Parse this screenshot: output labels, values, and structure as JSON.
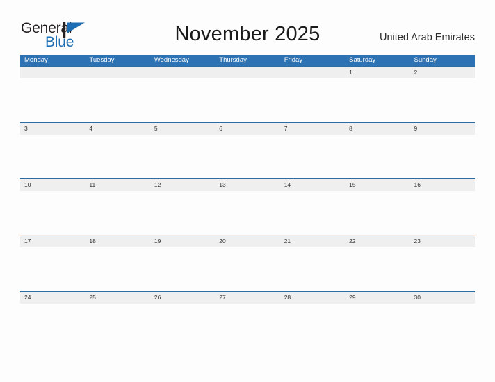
{
  "header": {
    "logo": {
      "name_part1": "General",
      "name_part2": "Blue",
      "flag_icon": "blue-flag-triangle-icon",
      "color_dark": "#231f20",
      "color_blue": "#1f6fb5"
    },
    "month_title": "November 2025",
    "locale": "United Arab Emirates"
  },
  "calendar": {
    "header_bg_color": "#2d72b2",
    "date_band_color": "#efefef",
    "accent_line_color": "#2e6da4",
    "weekdays": [
      "Monday",
      "Tuesday",
      "Wednesday",
      "Thursday",
      "Friday",
      "Saturday",
      "Sunday"
    ],
    "weeks": [
      [
        "",
        "",
        "",
        "",
        "",
        "1",
        "2"
      ],
      [
        "3",
        "4",
        "5",
        "6",
        "7",
        "8",
        "9"
      ],
      [
        "10",
        "11",
        "12",
        "13",
        "14",
        "15",
        "16"
      ],
      [
        "17",
        "18",
        "19",
        "20",
        "21",
        "22",
        "23"
      ],
      [
        "24",
        "25",
        "26",
        "27",
        "28",
        "29",
        "30"
      ]
    ]
  }
}
